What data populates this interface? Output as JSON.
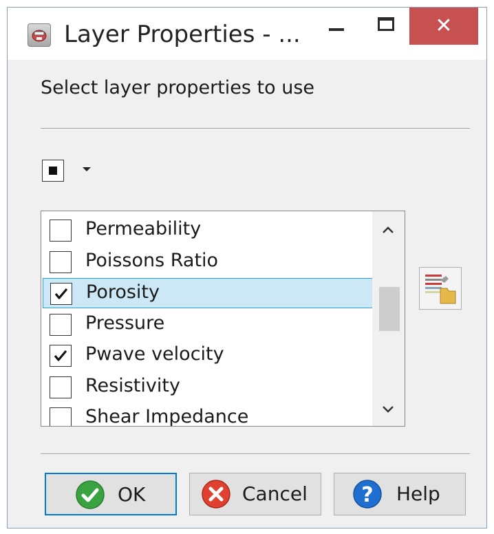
{
  "window": {
    "title": "Layer Properties - ...",
    "close_glyph": "✕"
  },
  "prompt": "Select layer properties to use",
  "select_all": {
    "state": "indeterminate",
    "icon": "select-all-checkbox",
    "dropdown_icon": "caret-down-icon"
  },
  "list": {
    "items": [
      {
        "label": "Permeability",
        "checked": false,
        "selected": false
      },
      {
        "label": "Poissons Ratio",
        "checked": false,
        "selected": false
      },
      {
        "label": "Porosity",
        "checked": true,
        "selected": true
      },
      {
        "label": "Pressure",
        "checked": false,
        "selected": false
      },
      {
        "label": "Pwave velocity",
        "checked": true,
        "selected": false
      },
      {
        "label": "Resistivity",
        "checked": false,
        "selected": false
      },
      {
        "label": "Shear Impedance",
        "checked": false,
        "selected": false
      }
    ]
  },
  "side_tool": {
    "icon": "layer-properties-folder-icon"
  },
  "buttons": {
    "ok": "OK",
    "cancel": "Cancel",
    "help": "Help"
  },
  "colors": {
    "selection_fill": "#cce8f7",
    "selection_border": "#26a0da",
    "close_button": "#c75050",
    "default_button_border": "#0078d7",
    "ok_icon": "#3aa340",
    "cancel_icon": "#e04030",
    "help_icon": "#1e6fd0"
  }
}
